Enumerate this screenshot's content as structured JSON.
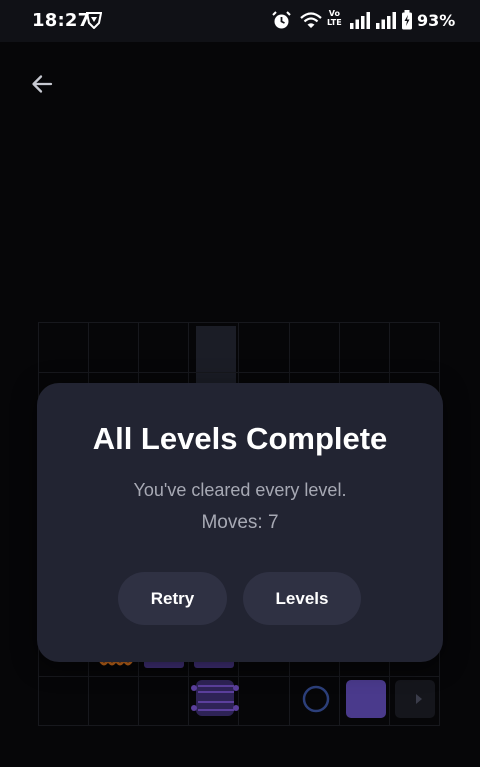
{
  "status_bar": {
    "time": "18:27",
    "volte": "Vo\nLTE",
    "battery_percent": "93%",
    "icons": [
      "vpn-shield-icon",
      "alarm-icon",
      "wifi-icon",
      "volte-icon",
      "signal-icon",
      "signal-icon",
      "battery-icon"
    ]
  },
  "nav": {
    "back_icon": "arrow-left-icon"
  },
  "dialog": {
    "title": "All Levels Complete",
    "subtitle": "You've cleared every level.",
    "moves": "Moves: 7",
    "retry_label": "Retry",
    "levels_label": "Levels"
  },
  "colors": {
    "background": "#060608",
    "dialog": "#222432",
    "button": "#2f3143",
    "piece_purple": "#5b3f9c",
    "piece_red": "#a0263b",
    "piece_orange": "#c86a1c"
  }
}
